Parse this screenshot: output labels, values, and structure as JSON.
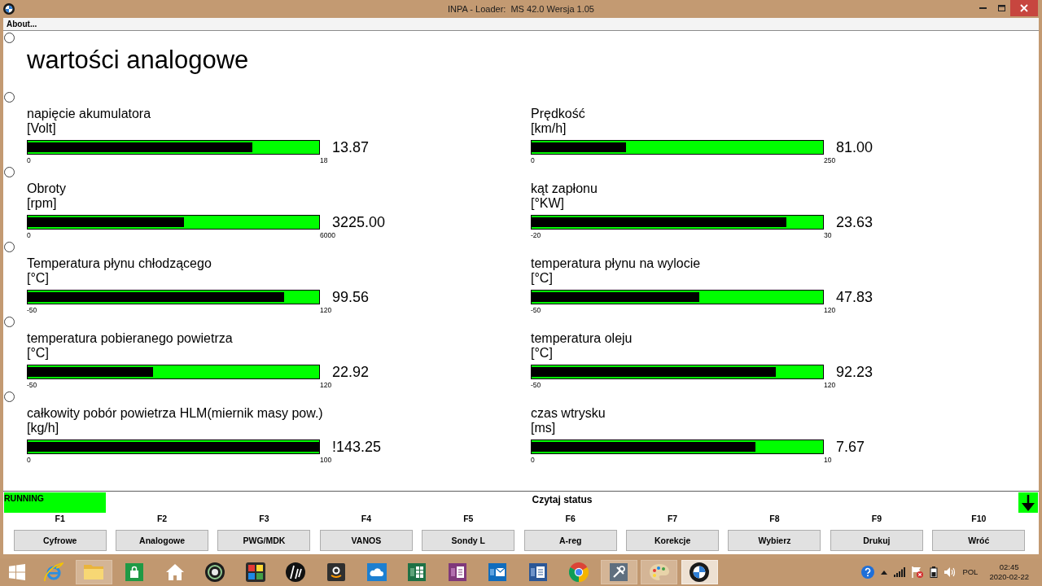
{
  "window": {
    "title": "INPA - Loader:  MS 42.0 Wersja 1.05"
  },
  "menu": [
    {
      "label": "About..."
    }
  ],
  "radio_buttons": [
    {
      "selected": false
    },
    {
      "selected": false
    },
    {
      "selected": false
    },
    {
      "selected": false
    },
    {
      "selected": false
    },
    {
      "selected": false
    }
  ],
  "heading": "wartości analogowe",
  "gauges": [
    {
      "label": "napięcie akumulatora",
      "unit": "[Volt]",
      "min": "0",
      "max": "18",
      "reading": "13.87",
      "level": 0.77
    },
    {
      "label": "Prędkość",
      "unit": "[km/h]",
      "min": "0",
      "max": "250",
      "reading": "81.00",
      "level": 0.324
    },
    {
      "label": "Obroty",
      "unit": "[rpm]",
      "min": "0",
      "max": "6000",
      "reading": "3225.00",
      "level": 0.5375
    },
    {
      "label": "kąt zapłonu",
      "unit": "[°KW]",
      "min": "-20",
      "max": "30",
      "reading": "23.63",
      "level": 0.873
    },
    {
      "label": "Temperatura płynu chłodzącego",
      "unit": "[°C]",
      "min": "-50",
      "max": "120",
      "reading": "99.56",
      "level": 0.88
    },
    {
      "label": "temperatura płynu na wylocie",
      "unit": "[°C]",
      "min": "-50",
      "max": "120",
      "reading": "47.83",
      "level": 0.575
    },
    {
      "label": "temperatura pobieranego powietrza",
      "unit": "[°C]",
      "min": "-50",
      "max": "120",
      "reading": "22.92",
      "level": 0.429
    },
    {
      "label": "temperatura oleju",
      "unit": "[°C]",
      "min": "-50",
      "max": "120",
      "reading": "92.23",
      "level": 0.837
    },
    {
      "label": "całkowity pobór powietrza HLM(miernik masy pow.)",
      "unit": "[kg/h]",
      "min": "0",
      "max": "100",
      "reading": "!143.25",
      "level": 1
    },
    {
      "label": "czas wtrysku",
      "unit": "[ms]",
      "min": "0",
      "max": "10",
      "reading": "7.67",
      "level": 0.767
    }
  ],
  "status_bar": {
    "state": "RUNNING",
    "message": "Czytaj status"
  },
  "function_keys": [
    {
      "key": "F1",
      "label": "Cyfrowe"
    },
    {
      "key": "F2",
      "label": "Analogowe"
    },
    {
      "key": "F3",
      "label": "PWG/MDK"
    },
    {
      "key": "F4",
      "label": "VANOS"
    },
    {
      "key": "F5",
      "label": "Sondy L"
    },
    {
      "key": "F6",
      "label": "A-reg"
    },
    {
      "key": "F7",
      "label": "Korekcje"
    },
    {
      "key": "F8",
      "label": "Wybierz"
    },
    {
      "key": "F9",
      "label": "Drukuj"
    },
    {
      "key": "F10",
      "label": "Wróć"
    }
  ],
  "taskbar": {
    "apps": [
      {
        "running": false,
        "selected": false
      },
      {
        "running": true,
        "selected": false
      },
      {
        "running": false,
        "selected": false
      },
      {
        "running": false,
        "selected": false
      },
      {
        "running": false,
        "selected": false
      },
      {
        "running": false,
        "selected": false
      },
      {
        "running": false,
        "selected": false
      },
      {
        "running": false,
        "selected": false
      },
      {
        "running": false,
        "selected": false
      },
      {
        "running": false,
        "selected": false
      },
      {
        "running": false,
        "selected": false
      },
      {
        "running": false,
        "selected": false
      },
      {
        "running": false,
        "selected": false
      },
      {
        "running": false,
        "selected": false
      },
      {
        "running": true,
        "selected": false
      },
      {
        "running": true,
        "selected": false
      },
      {
        "running": true,
        "selected": true
      }
    ],
    "language": "POL",
    "time": "02:45",
    "date": "2020-02-22"
  }
}
